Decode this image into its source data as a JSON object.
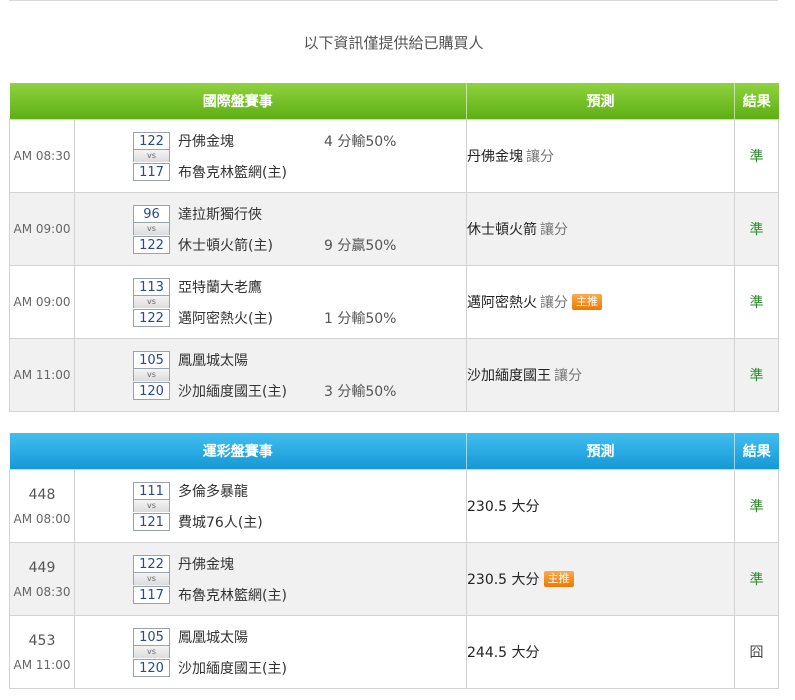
{
  "notice": "以下資訊僅提供給已購買人",
  "sections": [
    {
      "headers": {
        "event": "國際盤賽事",
        "prediction": "預測",
        "result": "結果"
      },
      "rows": [
        {
          "num": "",
          "time": "AM 08:30",
          "away_score": "122",
          "away": "丹佛金塊",
          "home_score": "117",
          "home": "布魯克林籃網(主)",
          "line_text": "4 分輸50%",
          "line_row": "top",
          "pick": "丹佛金塊",
          "pick_type": "讓分",
          "badge": "",
          "result": "準"
        },
        {
          "num": "",
          "time": "AM 09:00",
          "away_score": "96",
          "away": "達拉斯獨行俠",
          "home_score": "122",
          "home": "休士頓火箭(主)",
          "line_text": "9 分贏50%",
          "line_row": "bottom",
          "pick": "休士頓火箭",
          "pick_type": "讓分",
          "badge": "",
          "result": "準"
        },
        {
          "num": "",
          "time": "AM 09:00",
          "away_score": "113",
          "away": "亞特蘭大老鷹",
          "home_score": "122",
          "home": "邁阿密熱火(主)",
          "line_text": "1 分輸50%",
          "line_row": "bottom",
          "pick": "邁阿密熱火",
          "pick_type": "讓分",
          "badge": "主推",
          "result": "準"
        },
        {
          "num": "",
          "time": "AM 11:00",
          "away_score": "105",
          "away": "鳳凰城太陽",
          "home_score": "120",
          "home": "沙加緬度國王(主)",
          "line_text": "3 分輸50%",
          "line_row": "bottom",
          "pick": "沙加緬度國王",
          "pick_type": "讓分",
          "badge": "",
          "result": "準"
        }
      ]
    },
    {
      "headers": {
        "event": "運彩盤賽事",
        "prediction": "預測",
        "result": "結果"
      },
      "rows": [
        {
          "num": "448",
          "time": "AM 08:00",
          "away_score": "111",
          "away": "多倫多暴龍",
          "home_score": "121",
          "home": "費城76人(主)",
          "line_text": "",
          "line_row": "",
          "pick": "230.5 大分",
          "pick_type": "",
          "badge": "",
          "result": "準"
        },
        {
          "num": "449",
          "time": "AM 08:30",
          "away_score": "122",
          "away": "丹佛金塊",
          "home_score": "117",
          "home": "布魯克林籃網(主)",
          "line_text": "",
          "line_row": "",
          "pick": "230.5 大分",
          "pick_type": "",
          "badge": "主推",
          "result": "準"
        },
        {
          "num": "453",
          "time": "AM 11:00",
          "away_score": "105",
          "away": "鳳凰城太陽",
          "home_score": "120",
          "home": "沙加緬度國王(主)",
          "line_text": "",
          "line_row": "",
          "pick": "244.5 大分",
          "pick_type": "",
          "badge": "",
          "result": "囧"
        }
      ]
    }
  ],
  "vs_label": "vs",
  "colors": {
    "green_header": "#6cbf1f",
    "blue_header": "#1ea6e0",
    "badge": "#f08a1c",
    "hit": "#2a8a2a"
  }
}
